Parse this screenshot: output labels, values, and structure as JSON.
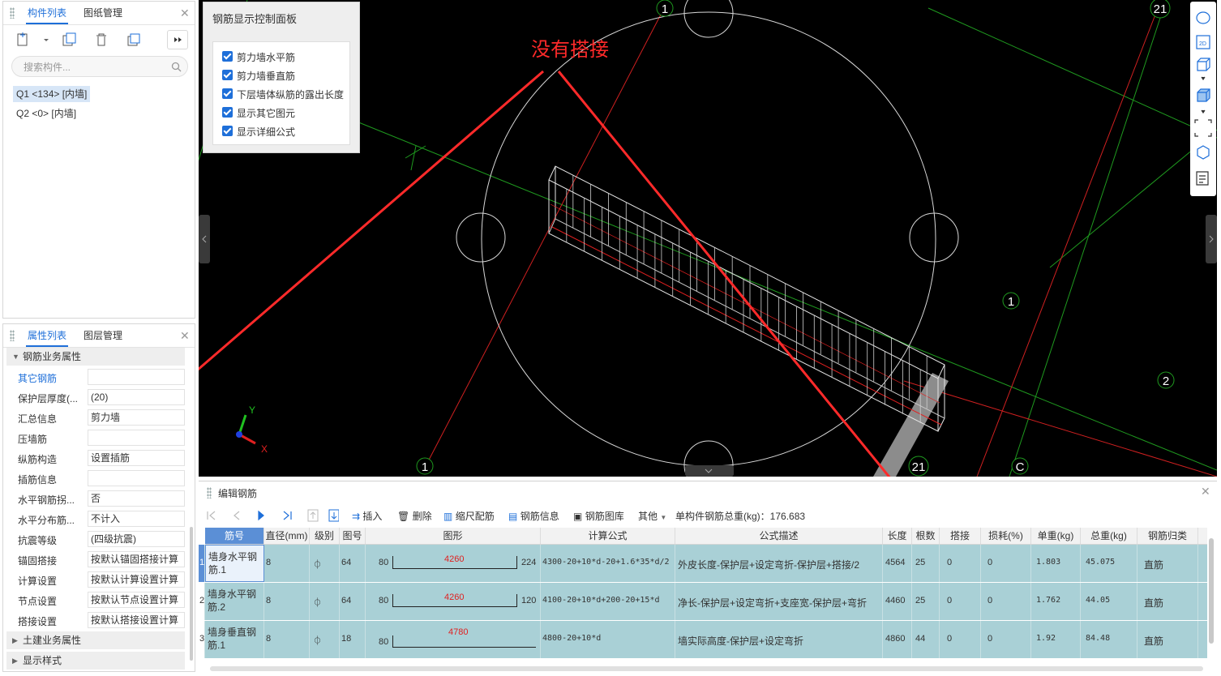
{
  "component_panel": {
    "tabs": [
      "构件列表",
      "图纸管理"
    ],
    "search_placeholder": "搜索构件...",
    "items": [
      "Q1 <134> [内墙]",
      "Q2 <0> [内墙]"
    ]
  },
  "property_panel": {
    "tabs": [
      "属性列表",
      "图层管理"
    ],
    "section_rebar": "钢筋业务属性",
    "properties": [
      {
        "label": "其它钢筋",
        "value": ""
      },
      {
        "label": "保护层厚度(...",
        "value": "(20)"
      },
      {
        "label": "汇总信息",
        "value": "剪力墙"
      },
      {
        "label": "压墙筋",
        "value": ""
      },
      {
        "label": "纵筋构造",
        "value": "设置插筋"
      },
      {
        "label": "插筋信息",
        "value": ""
      },
      {
        "label": "水平钢筋拐...",
        "value": "否"
      },
      {
        "label": "水平分布筋...",
        "value": "不计入"
      },
      {
        "label": "抗震等级",
        "value": "(四级抗震)"
      },
      {
        "label": "锚固搭接",
        "value": "按默认锚固搭接计算"
      },
      {
        "label": "计算设置",
        "value": "按默认计算设置计算"
      },
      {
        "label": "节点设置",
        "value": "按默认节点设置计算"
      },
      {
        "label": "搭接设置",
        "value": "按默认搭接设置计算"
      }
    ],
    "section_civil": "土建业务属性",
    "section_display": "显示样式"
  },
  "control_panel": {
    "title": "钢筋显示控制面板",
    "options": [
      "剪力墙水平筋",
      "剪力墙垂直筋",
      "下层墙体纵筋的露出长度",
      "显示其它图元",
      "显示详细公式"
    ]
  },
  "viewport": {
    "annotation": "没有搭接",
    "annotation_color": "#ff2a2a",
    "axis_labels": [
      "1",
      "21",
      "1",
      "2",
      "1",
      "21",
      "C"
    ],
    "axis_x": "X",
    "axis_y": "Y"
  },
  "editor": {
    "title": "编辑钢筋",
    "toolbar": {
      "insert": "插入",
      "delete": "删除",
      "scale": "缩尺配筋",
      "info": "钢筋信息",
      "library": "钢筋图库",
      "other": "其他",
      "total": "单构件钢筋总重(kg)：176.683"
    },
    "columns": [
      "筋号",
      "直径(mm)",
      "级别",
      "图号",
      "图形",
      "计算公式",
      "公式描述",
      "长度",
      "根数",
      "搭接",
      "损耗(%)",
      "单重(kg)",
      "总重(kg)",
      "钢筋归类"
    ],
    "rows": [
      {
        "num": "1",
        "name": "墙身水平钢筋.1",
        "dia": "8",
        "grade": "⏀",
        "fig": "64",
        "left": "80",
        "mid": "4260",
        "right": "224",
        "formula": "4300-20+10*d-20+1.6*35*d/2",
        "desc": "外皮长度-保护层+设定弯折-保护层+搭接/2",
        "length": "4564",
        "count": "25",
        "lap": "0",
        "loss": "0",
        "unit": "1.803",
        "total": "45.075",
        "cat": "直筋"
      },
      {
        "num": "2",
        "name": "墙身水平钢筋.2",
        "dia": "8",
        "grade": "⏀",
        "fig": "64",
        "left": "80",
        "mid": "4260",
        "right": "120",
        "formula": "4100-20+10*d+200-20+15*d",
        "desc": "净长-保护层+设定弯折+支座宽-保护层+弯折",
        "length": "4460",
        "count": "25",
        "lap": "0",
        "loss": "0",
        "unit": "1.762",
        "total": "44.05",
        "cat": "直筋"
      },
      {
        "num": "3",
        "name": "墙身垂直钢筋.1",
        "dia": "8",
        "grade": "⏀",
        "fig": "18",
        "left": "80",
        "mid": "4780",
        "right": "",
        "formula": "4800-20+10*d",
        "desc": "墙实际高度-保护层+设定弯折",
        "length": "4860",
        "count": "44",
        "lap": "0",
        "loss": "0",
        "unit": "1.92",
        "total": "84.48",
        "cat": "直筋"
      }
    ]
  },
  "colors": {
    "accent": "#1e6fd9",
    "row_bg": "#a9d0d6",
    "rebar_red": "#e02020"
  }
}
